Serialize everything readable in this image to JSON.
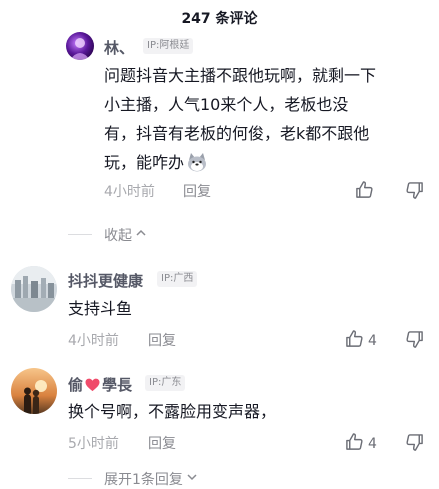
{
  "header": {
    "title": "247 条评论"
  },
  "comments": [
    {
      "username": "林、",
      "ip": "IP:阿根廷",
      "text_lines": [
        "问题抖音大主播不跟他玩啊，就剩一下",
        "小主播，人气10来个人，老板也没",
        "有，抖音有老板的何俊，老k都不跟他",
        "玩，能咋办"
      ],
      "time": "4小时前",
      "reply_label": "回复",
      "like_count": ""
    },
    {
      "username": "抖抖更健康",
      "ip": "IP:广西",
      "text_lines": [
        "支持斗鱼"
      ],
      "time": "4小时前",
      "reply_label": "回复",
      "like_count": "4"
    },
    {
      "username_parts": [
        "偷",
        "學長"
      ],
      "ip": "IP:广东",
      "text_lines": [
        "换个号啊，不露脸用变声器，"
      ],
      "time": "5小时前",
      "reply_label": "回复",
      "like_count": "4"
    }
  ],
  "thread_controls": {
    "collapse_label": "收起",
    "expand_label": "展开1条回复"
  },
  "icons": {
    "like": "thumbs-up-icon",
    "dislike": "thumbs-down-icon",
    "chevron_up": "chevron-up-icon",
    "chevron_down": "chevron-down-icon",
    "emoji": "doge-emoji-icon",
    "heart": "heart-emoji-icon"
  },
  "colors": {
    "username": "#555866",
    "meta": "#a8a9ae",
    "text": "#161823",
    "badge_bg": "#f2f2f4"
  }
}
